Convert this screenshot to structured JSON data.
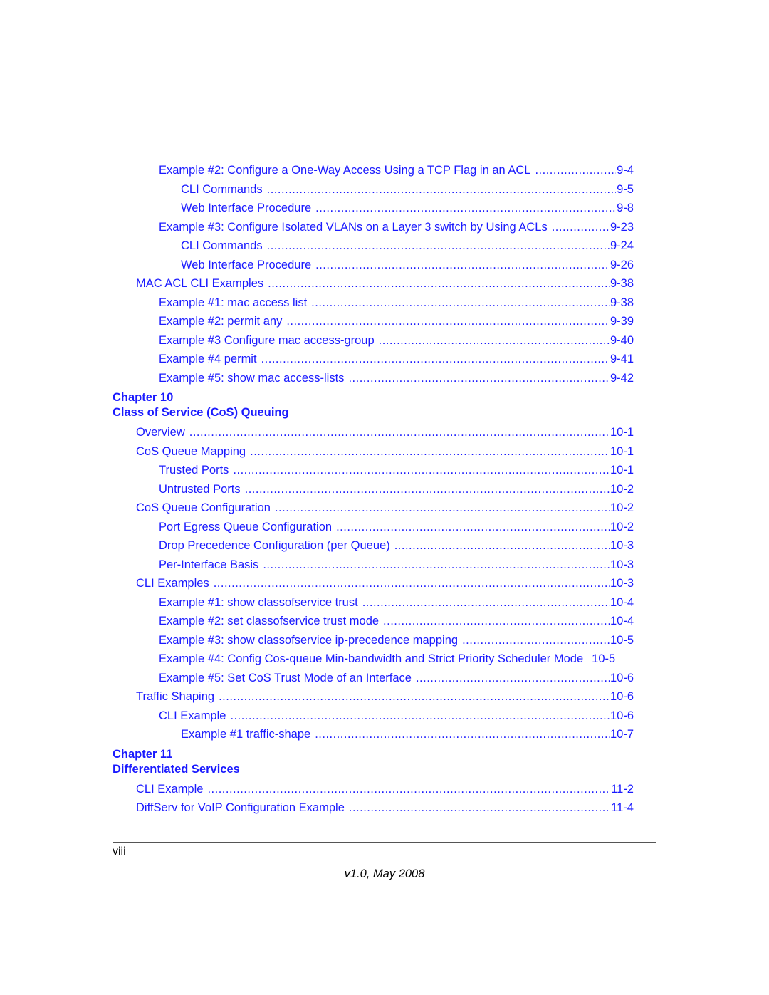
{
  "toc": {
    "sections": [
      {
        "chapter": null,
        "entries": [
          {
            "level": 2,
            "title": "Example #2: Configure a One-Way Access Using a TCP Flag in an ACL",
            "page": "9-4"
          },
          {
            "level": 3,
            "title": "CLI Commands",
            "page": "9-5"
          },
          {
            "level": 3,
            "title": "Web Interface Procedure",
            "page": "9-8"
          },
          {
            "level": 2,
            "title": "Example #3: Configure Isolated VLANs on a Layer 3 switch by Using ACLs",
            "page": "9-23"
          },
          {
            "level": 3,
            "title": "CLI Commands",
            "page": "9-24"
          },
          {
            "level": 3,
            "title": "Web Interface Procedure",
            "page": "9-26"
          },
          {
            "level": 1,
            "title": "MAC ACL CLI Examples",
            "page": "9-38"
          },
          {
            "level": 2,
            "title": "Example #1: mac access list",
            "page": "9-38"
          },
          {
            "level": 2,
            "title": "Example #2: permit any",
            "page": "9-39"
          },
          {
            "level": 2,
            "title": "Example #3 Configure mac access-group",
            "page": "9-40"
          },
          {
            "level": 2,
            "title": "Example #4 permit",
            "page": "9-41"
          },
          {
            "level": 2,
            "title": "Example #5: show mac access-lists",
            "page": "9-42"
          }
        ]
      },
      {
        "chapter": {
          "label": "Chapter 10",
          "title": "Class of Service (CoS) Queuing"
        },
        "entries": [
          {
            "level": 1,
            "title": "Overview",
            "page": "10-1"
          },
          {
            "level": 1,
            "title": "CoS Queue Mapping",
            "page": "10-1"
          },
          {
            "level": 2,
            "title": "Trusted Ports",
            "page": "10-1"
          },
          {
            "level": 2,
            "title": "Untrusted Ports",
            "page": "10-2"
          },
          {
            "level": 1,
            "title": "CoS Queue Configuration",
            "page": "10-2"
          },
          {
            "level": 2,
            "title": "Port Egress Queue Configuration",
            "page": "10-2"
          },
          {
            "level": 2,
            "title": "Drop Precedence Configuration (per Queue)",
            "page": "10-3"
          },
          {
            "level": 2,
            "title": "Per-Interface Basis",
            "page": "10-3"
          },
          {
            "level": 1,
            "title": "CLI Examples",
            "page": "10-3"
          },
          {
            "level": 2,
            "title": "Example #1: show classofservice trust",
            "page": "10-4"
          },
          {
            "level": 2,
            "title": "Example #2: set classofservice trust mode",
            "page": "10-4"
          },
          {
            "level": 2,
            "title": "Example #3: show classofservice ip-precedence mapping",
            "page": "10-5"
          },
          {
            "level": 2,
            "title": "Example #4: Config Cos-queue Min-bandwidth and Strict Priority Scheduler Mode",
            "page": "10-5",
            "no_leader": true
          },
          {
            "level": 2,
            "title": "Example #5: Set CoS Trust Mode of an Interface",
            "page": "10-6"
          },
          {
            "level": 1,
            "title": "Traffic Shaping",
            "page": "10-6"
          },
          {
            "level": 2,
            "title": "CLI Example",
            "page": "10-6"
          },
          {
            "level": 3,
            "title": "Example #1 traffic-shape",
            "page": "10-7"
          }
        ]
      },
      {
        "chapter": {
          "label": "Chapter 11",
          "title": "Differentiated Services"
        },
        "entries": [
          {
            "level": 1,
            "title": "CLI Example",
            "page": "11-2"
          },
          {
            "level": 1,
            "title": "DiffServ for VoIP Configuration Example",
            "page": "11-4"
          }
        ]
      }
    ]
  },
  "footer": {
    "page_number": "viii",
    "version": "v1.0, May 2008"
  },
  "colors": {
    "link": "#1a1aff",
    "rule": "#555555",
    "text": "#000000"
  }
}
